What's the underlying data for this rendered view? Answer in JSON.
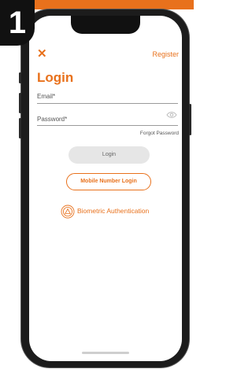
{
  "step": {
    "number": "1"
  },
  "colors": {
    "accent": "#e8711c",
    "badge_bg": "#111111",
    "text_dark": "#333333"
  },
  "header": {
    "close_icon": "close-x-icon",
    "register_label": "Register"
  },
  "login_form": {
    "title": "Login",
    "email_label": "Email*",
    "password_label": "Password*",
    "password_toggle_icon": "eye-icon",
    "forgot_password_label": "Forgot Password",
    "login_button_label": "Login",
    "mobile_login_button_label": "Mobile Number Login",
    "biometric_icon": "fingerprint-shield-icon",
    "biometric_label": "Biometric Authentication"
  }
}
